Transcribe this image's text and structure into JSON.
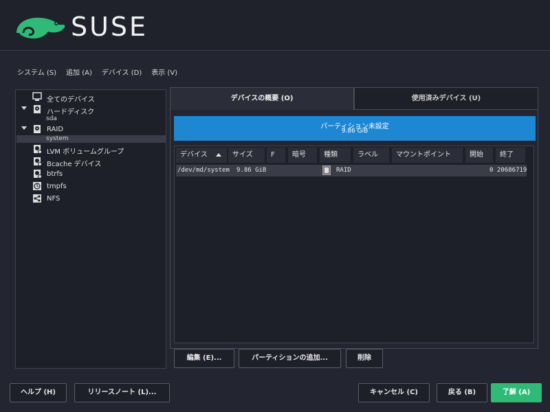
{
  "brand": {
    "name": "SUSE",
    "accent": "#30ba78"
  },
  "menu": [
    {
      "label": "システム (S)"
    },
    {
      "label": "追加 (A)"
    },
    {
      "label": "デバイス (D)"
    },
    {
      "label": "表示 (V)"
    }
  ],
  "tree": {
    "all_devices": "全てのデバイス",
    "hard_disk": "ハードディスク",
    "sda": "sda",
    "raid": "RAID",
    "system": "system",
    "lvm": "LVM ボリュームグループ",
    "bcache": "Bcache デバイス",
    "btrfs": "btrfs",
    "tmpfs": "tmpfs",
    "nfs": "NFS"
  },
  "tabs": {
    "overview": "デバイスの概要 (O)",
    "used": "使用済みデバイス (U)"
  },
  "summary": {
    "line1": "パーティション未設定",
    "line2": "9.86 GiB"
  },
  "table": {
    "headers": [
      "デバイス",
      "サイズ",
      "F",
      "暗号",
      "種類",
      "ラベル",
      "マウントポイント",
      "開始",
      "終了"
    ],
    "row": {
      "device": "/dev/md/system",
      "size": "9.86 GiB",
      "type": "RAID",
      "start": "0",
      "end": "20686719"
    }
  },
  "actions": {
    "edit": "編集 (E)...",
    "add_partition": "パーティションの追加...",
    "delete": "削除"
  },
  "footer": {
    "help": "ヘルプ (H)",
    "release_notes": "リリースノート (L)...",
    "cancel": "キャンセル (C)",
    "back": "戻る (B)",
    "ok": "了解 (A)"
  }
}
